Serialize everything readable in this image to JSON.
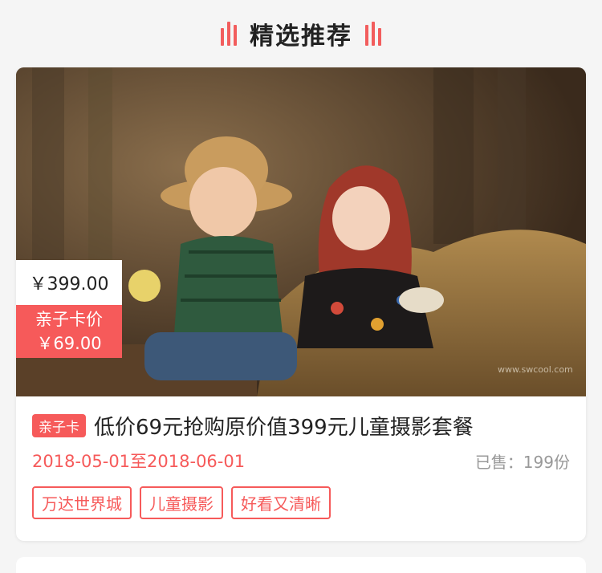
{
  "section": {
    "title": "精选推荐"
  },
  "product": {
    "image_alt": "two toddlers sitting in hay, one in straw hat and green plaid shirt, one in floral headscarf",
    "original_price": "￥399.00",
    "card_price_label": "亲子卡价",
    "card_price": "￥69.00",
    "badge": "亲子卡",
    "title": "低价69元抢购原价值399元儿童摄影套餐",
    "date_range": "2018-05-01至2018-06-01",
    "sold": "已售：199份",
    "tags": [
      "万达世界城",
      "儿童摄影",
      "好看又清晰"
    ],
    "watermark": "www.swcool.com"
  },
  "colors": {
    "accent": "#f65a5a",
    "text": "#222222",
    "muted": "#999999"
  }
}
